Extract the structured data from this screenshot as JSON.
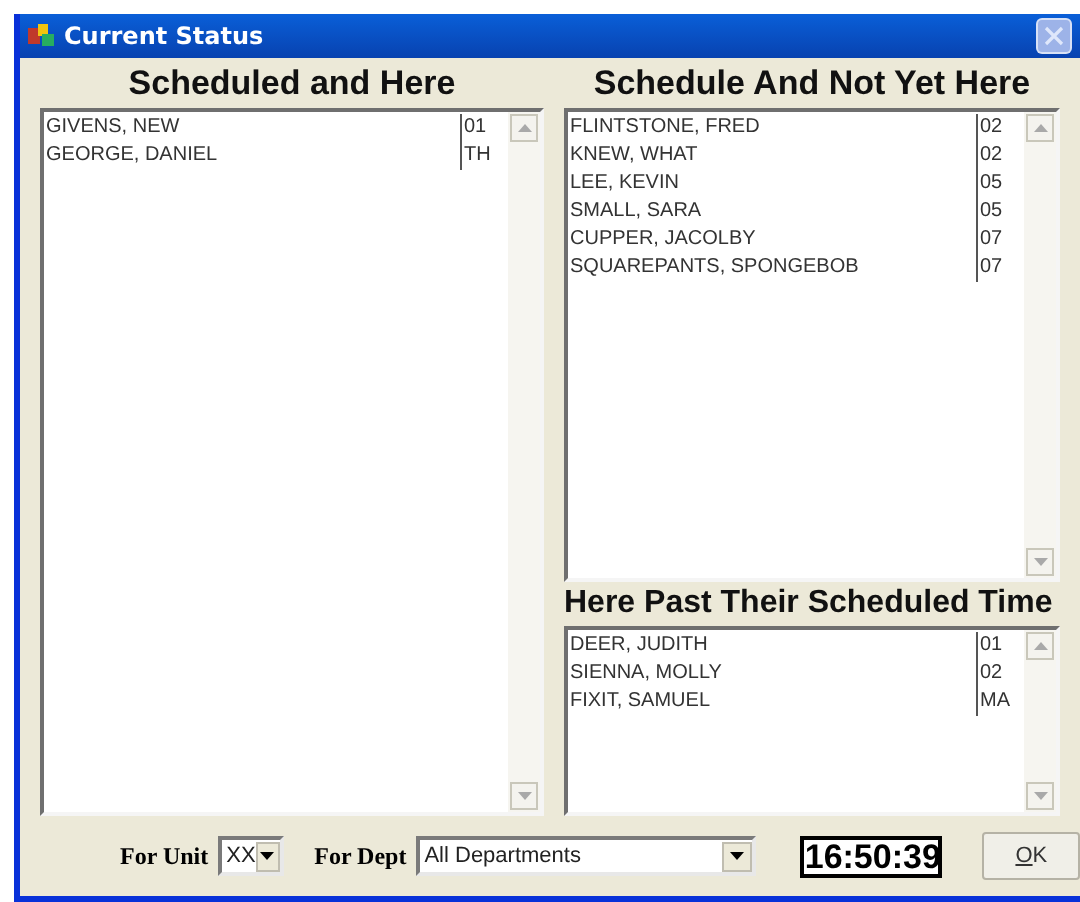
{
  "window": {
    "title": "Current Status"
  },
  "scheduled_and_here": {
    "heading": "Scheduled and Here",
    "rows": [
      {
        "name": "GIVENS, NEW",
        "code": "01"
      },
      {
        "name": "GEORGE, DANIEL",
        "code": "TH"
      }
    ]
  },
  "scheduled_not_here": {
    "heading": "Schedule And Not Yet Here",
    "rows": [
      {
        "name": "FLINTSTONE, FRED",
        "code": "02"
      },
      {
        "name": "KNEW, WHAT",
        "code": "02"
      },
      {
        "name": "LEE, KEVIN",
        "code": "05"
      },
      {
        "name": "SMALL, SARA",
        "code": "05"
      },
      {
        "name": "CUPPER, JACOLBY",
        "code": "07"
      },
      {
        "name": "SQUAREPANTS, SPONGEBOB",
        "code": "07"
      }
    ]
  },
  "past_scheduled_time": {
    "heading": "Here Past Their Scheduled Time",
    "rows": [
      {
        "name": "DEER, JUDITH",
        "code": "01"
      },
      {
        "name": "SIENNA, MOLLY",
        "code": "02"
      },
      {
        "name": "FIXIT, SAMUEL",
        "code": "MA"
      }
    ]
  },
  "footer": {
    "unit_label": "For Unit",
    "unit_value": "XX",
    "dept_label": "For Dept",
    "dept_value": "All Departments",
    "clock": "16:50:39",
    "ok_button": "OK"
  }
}
